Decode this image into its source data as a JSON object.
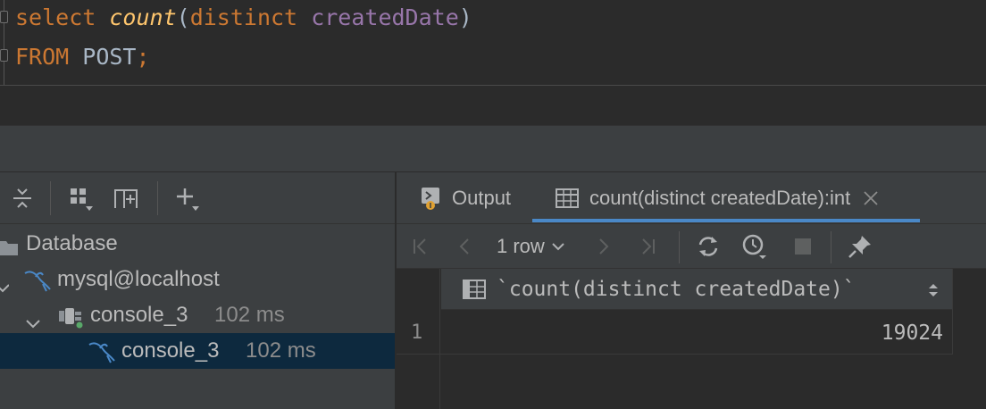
{
  "editor": {
    "line1": {
      "select": "select",
      "count": "count",
      "open_paren": "(",
      "distinct": "distinct",
      "column": "createdDate",
      "close_paren": ")"
    },
    "line2": {
      "from": "FROM",
      "table": "POST",
      "semicolon": ";"
    }
  },
  "services": {
    "toolbar_icons": [
      "collapse-all-icon",
      "group-by-icon",
      "add-service-icon",
      "add-icon"
    ],
    "tree": [
      {
        "label": "Database"
      },
      {
        "label": "mysql@localhost"
      },
      {
        "label": "console_3",
        "time": "102 ms"
      },
      {
        "label": "console_3",
        "time": "102 ms",
        "selected": true
      }
    ]
  },
  "results": {
    "tabs": [
      {
        "label": "Output",
        "icon": "output-icon"
      },
      {
        "label": "count(distinct createdDate):int",
        "icon": "table-icon",
        "active": true
      }
    ],
    "row_count_label": "1 row",
    "toolbar_icons": [
      "first-page-icon",
      "prev-page-icon",
      "next-page-icon",
      "last-page-icon",
      "refresh-icon",
      "history-icon",
      "stop-icon",
      "pin-icon"
    ],
    "column_header": "`count(distinct createdDate)`",
    "rows": [
      {
        "num": "1",
        "value": "19024"
      }
    ]
  },
  "colors": {
    "keyword": "#cc7832",
    "function": "#ffc66d",
    "column": "#9876aa",
    "identifier": "#a9b7c6",
    "selection": "#0d293e",
    "accent": "#4a88c7"
  }
}
